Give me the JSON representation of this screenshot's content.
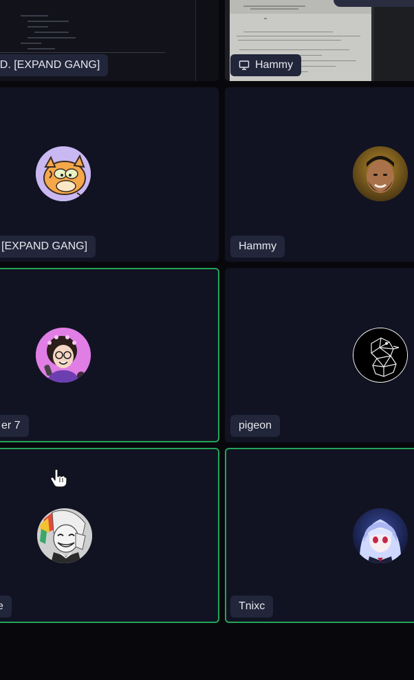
{
  "tiles": {
    "share_left": {
      "name": "M.D. [EXPAND GANG]"
    },
    "share_right": {
      "name": "Hammy",
      "icon": "monitor-icon"
    },
    "row2_left": {
      "name": "[EXPAND GANG]",
      "avatar": "garfield-avatar"
    },
    "row2_right": {
      "name": "Hammy",
      "avatar": "bearded-man-avatar"
    },
    "row3_left": {
      "name": "er 7",
      "avatar": "cartoon-glasses-avatar",
      "speaking": true
    },
    "row3_right": {
      "name": "pigeon",
      "avatar": "geometric-pigeon-avatar"
    },
    "row4_left": {
      "name": "e",
      "avatar": "anime-grin-avatar",
      "speaking": true
    },
    "row4_right": {
      "name": "Tnixc",
      "avatar": "anime-blue-hair-avatar",
      "speaking": true
    }
  },
  "colors": {
    "tile_bg": "#111322",
    "speaking_border": "#23a55a",
    "name_tag_bg": "#22263a",
    "name_text": "#e6e7ee"
  }
}
